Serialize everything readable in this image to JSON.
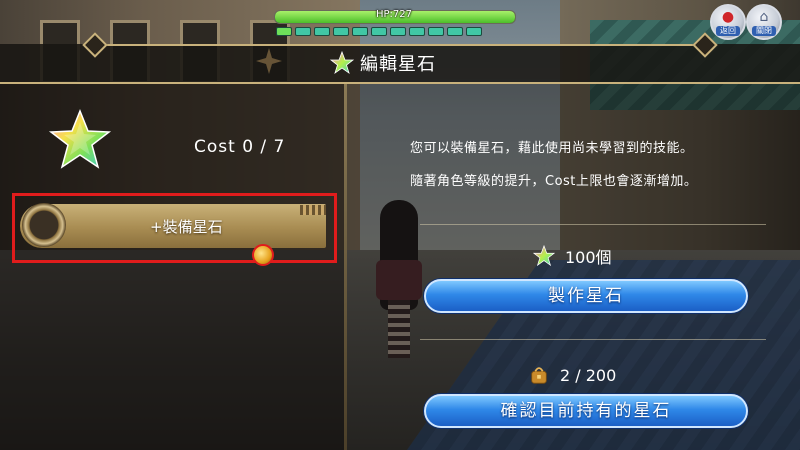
{
  "hud": {
    "hp_text": "HP:727",
    "mp_segments": 11,
    "back_label": "返回",
    "close_label": "關閉"
  },
  "header": {
    "title": "編輯星石"
  },
  "left_panel": {
    "cost_label": "Cost 0 / 7",
    "slot_label": "+裝備星石"
  },
  "right_panel": {
    "description_line1": "您可以裝備星石，藉此使用尚未學習到的技能。",
    "description_line2": "隨著角色等級的提升，Cost上限也會逐漸增加。",
    "stone_count": "100個",
    "craft_button": "製作星石",
    "inventory_count": "2 / 200",
    "confirm_button": "確認目前持有的星石"
  },
  "colors": {
    "accent_gold": "#c9b27c",
    "highlight_red": "#e01c1c",
    "button_blue": "#2f88e8",
    "hp_green": "#6ee05a"
  },
  "icons": [
    "back-icon",
    "close-icon",
    "star-stone-icon",
    "ribbon-icon",
    "bag-icon",
    "cursor-icon"
  ]
}
